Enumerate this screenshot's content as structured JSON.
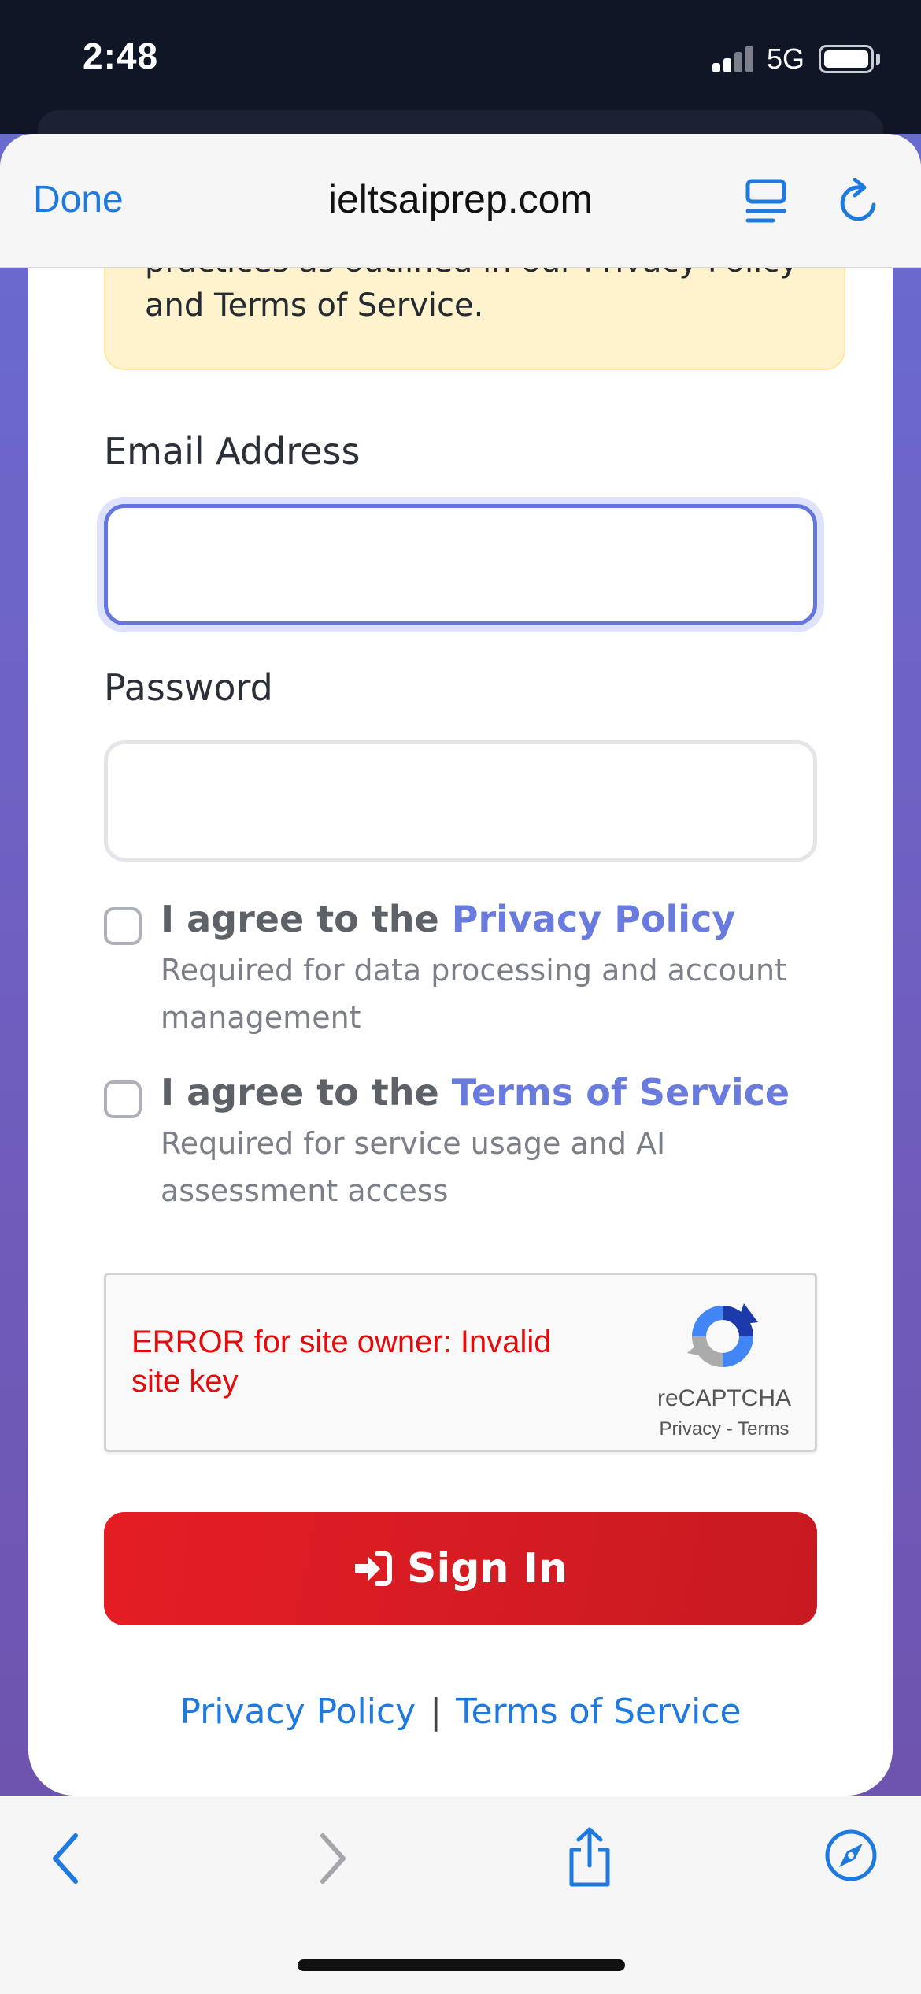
{
  "status_bar": {
    "time": "2:48",
    "network": "5G"
  },
  "browser": {
    "done_label": "Done",
    "url": "ieltsaiprep.com"
  },
  "notice": {
    "visible_text": "practices as outlined in our Privacy Policy and Terms of Service."
  },
  "form": {
    "email_label": "Email Address",
    "email_value": "",
    "password_label": "Password",
    "password_value": "",
    "privacy_agree": {
      "prefix": "I agree to the",
      "link": "Privacy Policy",
      "note": "Required for data processing and account management",
      "checked": false
    },
    "terms_agree": {
      "prefix": "I agree to the",
      "link": "Terms of Service",
      "note": "Required for service usage and AI assessment access",
      "checked": false
    },
    "captcha": {
      "error": "ERROR for site owner: Invalid site key",
      "brand": "reCAPTCHA",
      "privacy": "Privacy",
      "separator": "-",
      "terms": "Terms"
    },
    "submit_label": "Sign In"
  },
  "footer": {
    "privacy_link": "Privacy Policy",
    "separator": "|",
    "terms_link": "Terms of Service"
  },
  "colors": {
    "accent": "#6a7be0",
    "link_blue": "#1f7ae0",
    "submit_red": "#e51d24",
    "error_red": "#e30b0b",
    "notice_bg": "#fff3cd"
  },
  "toolbar": {
    "icons": [
      "back-icon",
      "forward-icon",
      "share-icon",
      "safari-compass-icon"
    ]
  }
}
